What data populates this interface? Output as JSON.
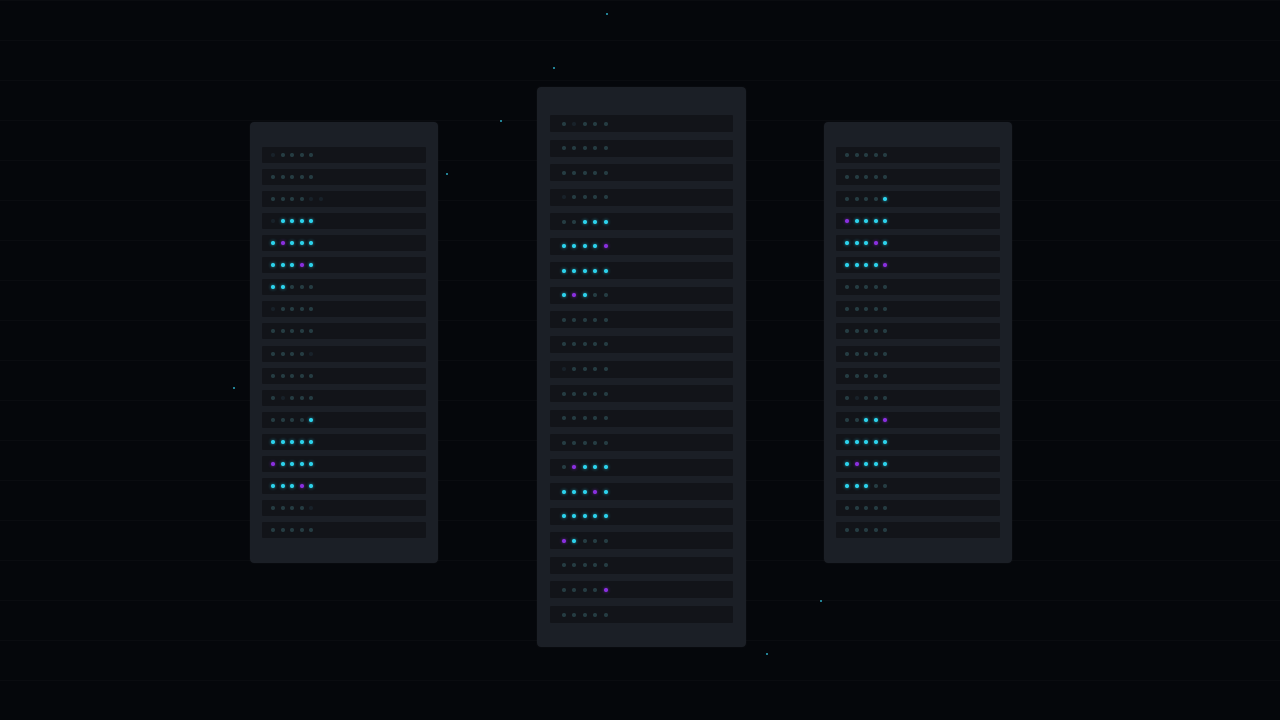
{
  "colors": {
    "background": "#05070b",
    "rack": "#1b1f26",
    "unit": "#121419",
    "led_off": "#2c4a50",
    "led_cyan": "#2cd3ec",
    "led_purple": "#8a2fe0",
    "particle": "#2ca8c0"
  },
  "racks": [
    {
      "name": "left",
      "units": [
        "doooo",
        "ooooo",
        "oooodd",
        "dcccc",
        "cpccc",
        "cccpc",
        "ccooo",
        "doooo",
        "ooooo",
        "ooood",
        "ooooo",
        "odooo",
        "ooooc",
        "ccccc",
        "pcccc",
        "cccpc",
        "ooood",
        "ooooo"
      ]
    },
    {
      "name": "center",
      "units": [
        "odooo",
        "ooooo",
        "ooooo",
        "doooo",
        "ooccc",
        "ccccp",
        "ccccc",
        "cpcoo",
        "ooooo",
        "ooooo",
        "doooo",
        "ooooo",
        "ooooo",
        "ooooo",
        "opccc",
        "cccpc",
        "ccccc",
        "pcooo",
        "ooooo",
        "oooop",
        "ooooo"
      ]
    },
    {
      "name": "right",
      "units": [
        "ooooo",
        "ooooo",
        "ooooc",
        "pcccc",
        "cccpc",
        "ccccp",
        "ooooo",
        "ooooo",
        "ooooo",
        "ooooo",
        "ooooo",
        "odooo",
        "ooccp",
        "ccccc",
        "cpccc",
        "cccoo",
        "ooooo",
        "ooooo"
      ]
    }
  ]
}
